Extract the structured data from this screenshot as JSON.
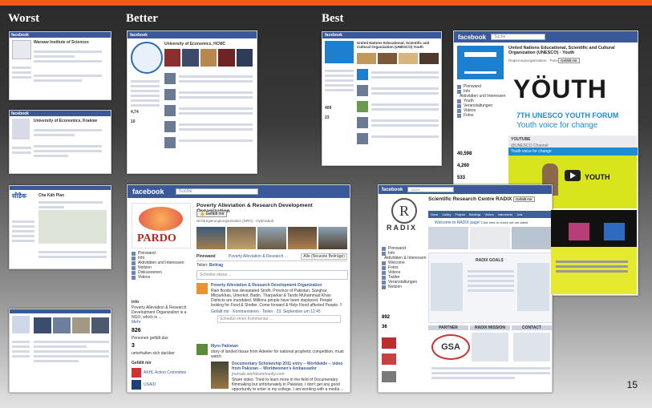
{
  "headings": {
    "worst": "Worst",
    "better": "Better",
    "best": "Best"
  },
  "slide_number": "15",
  "facebook_logo": "facebook",
  "shots": {
    "w1": {
      "title": "Warsaw Institute of Sciences"
    },
    "w2": {
      "title": "University of Economics, Krakow"
    },
    "w3": {
      "title": "Cha Kâh Plan"
    },
    "b1": {
      "title": "University of Economics, HCMC",
      "stat1": "4,74",
      "stat2": "10"
    },
    "pardo": {
      "search": "Suche",
      "title": "Poverty Alleviation & Research Development Organization",
      "like": "Gefällt mir",
      "category": "Nichtregierungsorganisation (NRO) · Hyderabad",
      "logo": "PARDO",
      "nav": [
        "Pinnwand",
        "Info",
        "Aktivitäten und Interessen",
        "Notizen",
        "Diskussionen",
        "Videos"
      ],
      "tabs": [
        "Pinnwand",
        "Poverty Alleviation & Research ...",
        "Alle (Neueste Beiträge)"
      ],
      "tab2": "Teilen:",
      "status": "Beitrag",
      "compose": "Schreibe etwas ...",
      "info_label": "Info",
      "info_text": "Poverty Alleviation & Research Development Organization is a NGO, which is ...",
      "more": "Mehr",
      "likes_count": "826",
      "likes_label": "Personen gefällt das",
      "talking_count": "3",
      "talking_label": "unterhalten sich darüber",
      "liked_label": "Gefällt mir",
      "liked1": "AKHL Action Committee",
      "liked2": "USAID",
      "post1_title": "Poverty Alleviation & Research Development Organization",
      "post1_text": "Rain floods has devastated Sindh, Province of Pakistan. Sanghar, Mirpurkhas, Umerkot, Badin, Tharparkar & Tando Muhammad Khan Districts are inundated. Millions people have been displaced. People looking for Food & Shelter. Come forward & Help Flood affected People. !!",
      "post1_meta": "Gefällt mir · Kommentieren · Teilen · 23. September um 12:45",
      "comment_placeholder": "Schreibe einen Kommentar ...",
      "post2_title": "Myro Pakistan",
      "post2_text": "story of landed tissue from Adeeler for national prophetic competition, must watch",
      "post3_title": "Documentary Scholarship 2011 entry -- Worldwide -- video from Pakistan -- Worldwomen's Ambassador",
      "post3_sub": "journals.worldcommunity.com",
      "post3_text": "Share video. Tried to learn more in the field of Documentary filmmaking but unfortunately in Pakistan. I don't get any good opportunity to enter in my college. I am working with a media ..."
    },
    "unesco_small": {
      "title": "United Nations Educational, Scientific and Cultural Organization (UNESCO) Youth",
      "count1": "409",
      "count2": "23"
    },
    "unesco_big": {
      "search": "Suche",
      "title": "United Nations Educational, Scientific and Cultural Organization (UNESCO) · Youth",
      "like": "Gefällt mir",
      "subtitle": "Regierungsorganisation · Paris",
      "nav": [
        "Pinnwand",
        "Info",
        "Aktivitäten und Interessen",
        "Youth",
        "Veranstaltungen",
        "Videos",
        "Fotos"
      ],
      "youth": "YÖUTH",
      "forum1": "7TH UNESCO YOUTH FORUM",
      "forum2": "Youth voice for change",
      "youtube": "YOUTUBE",
      "youtube_sub": "@UNESCO Channel",
      "video_title": "Youth voice for change",
      "video_word": "YOUTH",
      "stat1": "40,598",
      "stat2": "4,260",
      "stat3": "533"
    },
    "radix": {
      "search": "Suche",
      "title": "Scientific Research Centre RADIX",
      "like": "Gefällt mir",
      "logo": "RADIX",
      "tabs": [
        "Home",
        "Gallery",
        "Projects",
        "Buildings",
        "Visitors",
        "Instruments",
        "Jobs"
      ],
      "welcome": "Welcome to RADIX page!",
      "welcome2": "Click here to check out our latest",
      "nav": [
        "Pinnwand",
        "Info",
        "Aktivitäten & Interessen",
        "Welcome",
        "Fotos",
        "Videos",
        "Twitter",
        "Veranstaltungen",
        "Notizen"
      ],
      "goals": "RADIX GOALS",
      "section_headers": [
        "PARTNER",
        "RADIX MISSION",
        "CONTACT"
      ],
      "gsa": "GSA",
      "count1": "892",
      "count2": "36"
    }
  },
  "colors": {
    "fb_blue": "#3b5998",
    "accent": "#f05a1a",
    "youth_blue": "#1f8bd0",
    "youth_yellow": "#d9e51c"
  }
}
